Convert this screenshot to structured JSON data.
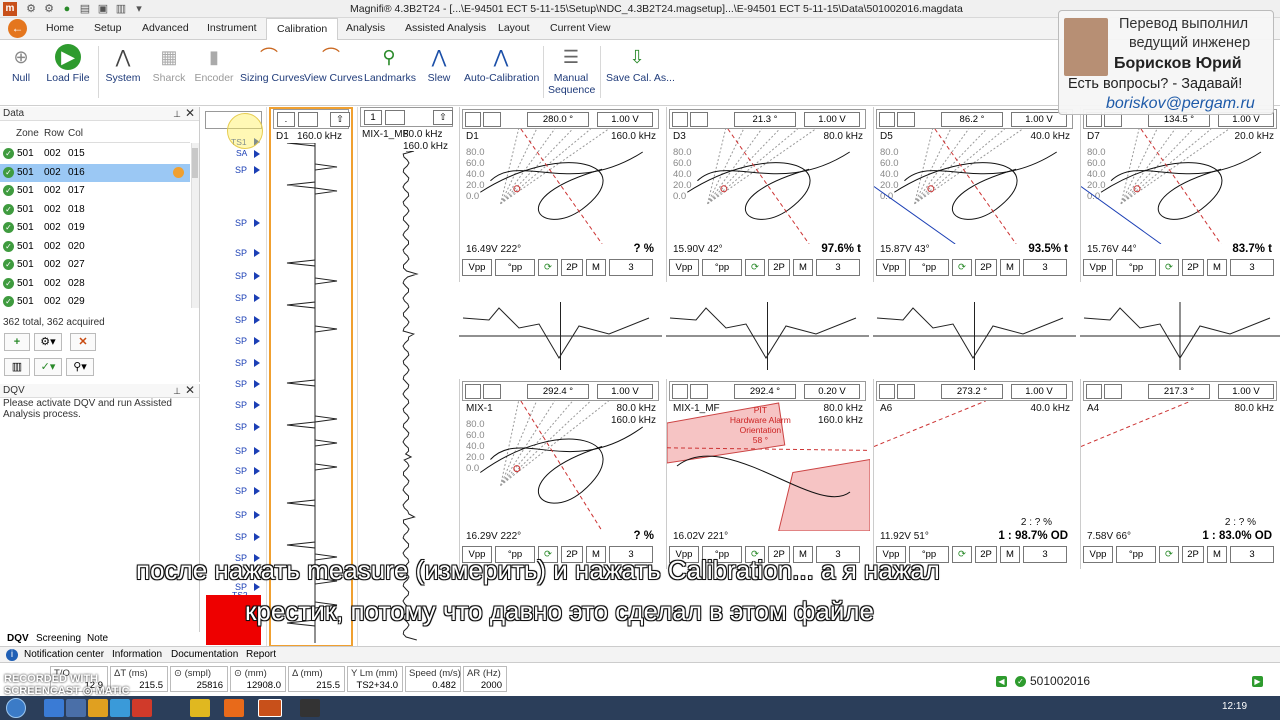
{
  "app": {
    "icon_letter": "m",
    "title": "Magnifi® 4.3B2T24 - [...\\E-94501 ECT 5-11-15\\Setup\\NDC_4.3B2T24.magsetup]...\\E-94501 ECT 5-11-15\\Data\\501002016.magdata"
  },
  "ribbon_tabs": [
    "Home",
    "Setup",
    "Advanced",
    "Instrument",
    "Calibration",
    "Analysis",
    "Assisted Analysis",
    "Layout",
    "Current View"
  ],
  "active_tab": "Calibration",
  "ribbon": {
    "null": "Null",
    "load_file": "Load File",
    "system": "System",
    "sharck": "Sharck",
    "encoder": "Encoder",
    "sizing_curves": "Sizing Curves",
    "view_curves": "View Curves",
    "landmarks": "Landmarks",
    "slew": "Slew",
    "auto_calibration": "Auto-Calibration",
    "manual_sequence_1": "Manual",
    "manual_sequence_2": "Sequence",
    "save_cal": "Save Cal. As..."
  },
  "data_panel": {
    "title": "Data",
    "columns": [
      "Zone",
      "Row",
      "Col"
    ],
    "rows": [
      {
        "zone": "501",
        "row": "002",
        "col": "015"
      },
      {
        "zone": "501",
        "row": "002",
        "col": "016"
      },
      {
        "zone": "501",
        "row": "002",
        "col": "017"
      },
      {
        "zone": "501",
        "row": "002",
        "col": "018"
      },
      {
        "zone": "501",
        "row": "002",
        "col": "019"
      },
      {
        "zone": "501",
        "row": "002",
        "col": "020"
      },
      {
        "zone": "501",
        "row": "002",
        "col": "027"
      },
      {
        "zone": "501",
        "row": "002",
        "col": "028"
      },
      {
        "zone": "501",
        "row": "002",
        "col": "029"
      }
    ],
    "selected_index": 1,
    "totals": "362 total, 362 acquired"
  },
  "dqv_panel": {
    "title": "DQV",
    "text": "Please activate DQV and run Assisted Analysis process."
  },
  "bottom_tabs": [
    "DQV",
    "Screening",
    "Note"
  ],
  "strip": {
    "labels": [
      "TS1",
      "SA",
      "SP"
    ],
    "sp_label": "SP",
    "ts2_label": "TS2"
  },
  "channels": {
    "strip1": {
      "name": "D1",
      "freq": "160.0 kHz",
      "sel": "1",
      "phase_box": "."
    },
    "strip2": {
      "name": "MIX-1_MF",
      "freq1": "80.0 kHz",
      "freq2": "160.0 kHz",
      "sel": "1"
    }
  },
  "lissajous_top": [
    {
      "rot": "280.0 °",
      "volt": "1.00 V",
      "name": "D1",
      "freq": "160.0 kHz",
      "reading": "16.49V 222°",
      "pct": "? %",
      "vpp": "Vpp",
      "pp": "°pp",
      "twop": "2P",
      "m": "M",
      "n": "3"
    },
    {
      "rot": "21.3 °",
      "volt": "1.00 V",
      "name": "D3",
      "freq": "80.0 kHz",
      "reading": "15.90V 42°",
      "pct": "97.6% t",
      "vpp": "Vpp",
      "pp": "°pp",
      "twop": "2P",
      "m": "M",
      "n": "3"
    },
    {
      "rot": "86.2 °",
      "volt": "1.00 V",
      "name": "D5",
      "freq": "40.0 kHz",
      "reading": "15.87V 43°",
      "pct": "93.5% t",
      "vpp": "Vpp",
      "pp": "°pp",
      "twop": "2P",
      "m": "M",
      "n": "3"
    },
    {
      "rot": "134.5 °",
      "volt": "1.00 V",
      "name": "D7",
      "freq": "20.0 kHz",
      "reading": "15.76V 44°",
      "pct": "83.7% t",
      "vpp": "Vpp",
      "pp": "°pp",
      "twop": "2P",
      "m": "M",
      "n": "3"
    }
  ],
  "lissajous_bottom": [
    {
      "rot": "292.4 °",
      "volt": "1.00 V",
      "name": "MIX-1",
      "freq": "80.0 kHz",
      "freq2": "160.0 kHz",
      "reading": "16.29V 222°",
      "pct": "? %",
      "vpp": "Vpp",
      "pp": "°pp",
      "twop": "2P",
      "m": "M",
      "n": "3"
    },
    {
      "rot": "292.4 °",
      "volt": "0.20 V",
      "name": "MIX-1_MF",
      "freq": "80.0 kHz",
      "freq2": "160.0 kHz",
      "reading": "16.02V 221°",
      "pct": "",
      "vpp": "Vpp",
      "pp": "°pp",
      "twop": "2P",
      "m": "M",
      "n": "3",
      "alarm_1": "PIT",
      "alarm_2": "Hardware Alarm",
      "alarm_3": "Orientation",
      "alarm_4": "58 °"
    },
    {
      "rot": "273.2 °",
      "volt": "1.00 V",
      "name": "A6",
      "freq": "40.0 kHz",
      "freq2": "",
      "reading": "11.92V 51°",
      "pct": "1 : 98.7% OD",
      "ratio": "2 : ? %",
      "vpp": "Vpp",
      "pp": "°pp",
      "twop": "2P",
      "m": "M",
      "n": "3"
    },
    {
      "rot": "217.3 °",
      "volt": "1.00 V",
      "name": "A4",
      "freq": "80.0 kHz",
      "freq2": "",
      "reading": "7.58V 66°",
      "pct": "1 : 83.0% OD",
      "ratio": "2 : ? %",
      "vpp": "Vpp",
      "pp": "°pp",
      "twop": "2P",
      "m": "M",
      "n": "3"
    }
  ],
  "grid_labels": [
    "80.0",
    "60.0",
    "40.0",
    "20.0",
    "0.0"
  ],
  "notification_bar": [
    "Notification center",
    "Information",
    "Documentation",
    "Report"
  ],
  "measurements": [
    {
      "k": "T/O",
      "v": "12.9"
    },
    {
      "k": "ΔT (ms)",
      "v": "215.5"
    },
    {
      "k": "⊙ (smpl)",
      "v": "25816"
    },
    {
      "k": "⊙ (mm)",
      "v": "12908.0"
    },
    {
      "k": "Δ (mm)",
      "v": "215.5"
    },
    {
      "k": "Y Lm (mm)",
      "v": "TS2+34.0"
    },
    {
      "k": "Speed (m/s)",
      "v": "0.482"
    },
    {
      "k": "AR (Hz)",
      "v": "2000"
    }
  ],
  "current_file": "501002016",
  "clock": "12:19",
  "watermark": {
    "line1": "RECORDED WITH",
    "line2": "SCREENCAST ◎ MATIC"
  },
  "overlay": {
    "line1": "Перевод выполнил",
    "line2": "ведущий инженер",
    "name": "Борисков Юрий",
    "line4": "Есть вопросы? - Задавай!",
    "email": "boriskov@pergam.ru"
  },
  "subtitles": {
    "line1": "после нажать measure (измерить) и нажать Calibration... а я нажал",
    "line2": "крестик, потому что давно это сделал в этом файле"
  },
  "colors": {
    "accent": "#e4761e",
    "selection": "#9bc8f4",
    "strip_border": "#f0a030",
    "alarm_fill": "#f6c4c4",
    "sp_blue": "#1b3fb5"
  }
}
